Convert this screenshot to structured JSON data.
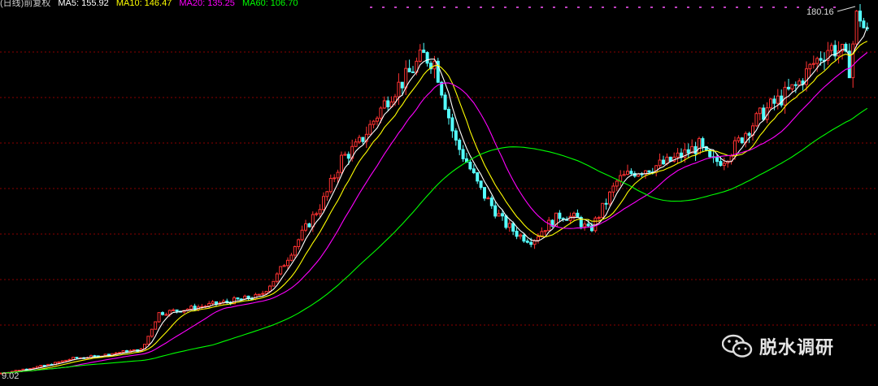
{
  "header": {
    "indicator": "(日线)前复权",
    "ma5": "MA5: 155.92",
    "ma10": "MA10: 146.47",
    "ma20: ": "",
    "ma20": "MA20: 135.25",
    "ma60": "MA60: 106.70"
  },
  "watermark": {
    "text": "脱水调研",
    "icon": "wechat-icon"
  },
  "colors": {
    "background": "#000000",
    "up": "#ff3232",
    "down": "#54ffff",
    "ma5": "#ffffff",
    "ma10": "#ffff00",
    "ma20": "#ff00ff",
    "ma60": "#00ff00",
    "grid": "#8b0000"
  },
  "chart_data": {
    "type": "candlestick",
    "title": "",
    "ymax_label": "180.16",
    "ymin_label": "9.02",
    "ylim": [
      9.02,
      180.16
    ],
    "grid": true,
    "series": [
      {
        "name": "MA5"
      },
      {
        "name": "MA10"
      },
      {
        "name": "MA20"
      },
      {
        "name": "MA60"
      }
    ],
    "close_path_points": [
      [
        0,
        10
      ],
      [
        30,
        12
      ],
      [
        60,
        14
      ],
      [
        90,
        17
      ],
      [
        120,
        18
      ],
      [
        150,
        20
      ],
      [
        175,
        21
      ],
      [
        195,
        38
      ],
      [
        230,
        40
      ],
      [
        260,
        42
      ],
      [
        290,
        44
      ],
      [
        320,
        46
      ],
      [
        340,
        55
      ],
      [
        360,
        68
      ],
      [
        380,
        80
      ],
      [
        400,
        92
      ],
      [
        420,
        110
      ],
      [
        440,
        116
      ],
      [
        460,
        128
      ],
      [
        480,
        140
      ],
      [
        500,
        148
      ],
      [
        520,
        158
      ],
      [
        535,
        155
      ],
      [
        545,
        140
      ],
      [
        560,
        118
      ],
      [
        575,
        108
      ],
      [
        590,
        96
      ],
      [
        605,
        88
      ],
      [
        620,
        80
      ],
      [
        640,
        74
      ],
      [
        655,
        72
      ],
      [
        670,
        78
      ],
      [
        690,
        84
      ],
      [
        710,
        82
      ],
      [
        725,
        76
      ],
      [
        740,
        86
      ],
      [
        760,
        100
      ],
      [
        780,
        104
      ],
      [
        800,
        106
      ],
      [
        820,
        108
      ],
      [
        840,
        112
      ],
      [
        860,
        116
      ],
      [
        875,
        108
      ],
      [
        890,
        110
      ],
      [
        905,
        116
      ],
      [
        920,
        124
      ],
      [
        940,
        132
      ],
      [
        960,
        138
      ],
      [
        980,
        144
      ],
      [
        1000,
        154
      ],
      [
        1020,
        162
      ],
      [
        1035,
        160
      ],
      [
        1045,
        152
      ],
      [
        1055,
        180
      ],
      [
        1065,
        168
      ]
    ]
  }
}
